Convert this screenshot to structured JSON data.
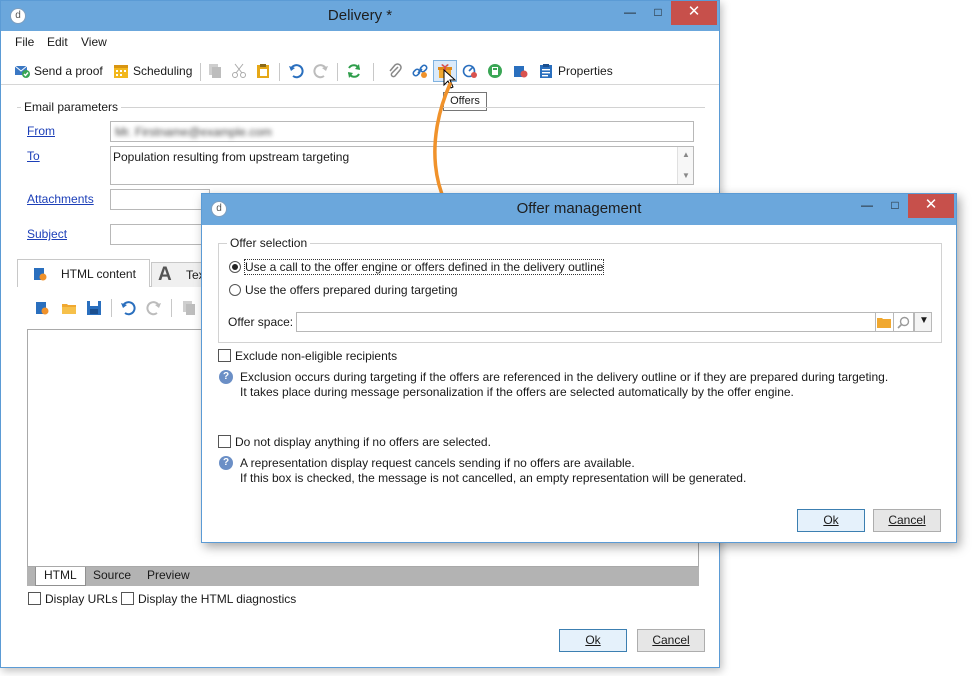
{
  "main_window": {
    "title": "Delivery *",
    "menu": [
      "File",
      "Edit",
      "View"
    ],
    "toolbar": {
      "send_proof": "Send a proof",
      "scheduling": "Scheduling",
      "properties": "Properties",
      "offers_tooltip": "Offers"
    },
    "email_params": {
      "legend": "Email parameters",
      "from_label": "From",
      "from_value": "Mr. Firstname@example.com",
      "to_label": "To",
      "to_value": "Population resulting from upstream targeting",
      "attachments_label": "Attachments",
      "subject_label": "Subject"
    },
    "content_tabs": {
      "html_content": "HTML content",
      "text_partial": "Tex"
    },
    "bottom_tabs": [
      "HTML",
      "Source",
      "Preview"
    ],
    "options": {
      "display_urls": "Display URLs",
      "display_html_diag": "Display the HTML diagnostics"
    },
    "buttons": {
      "ok": "Ok",
      "cancel": "Cancel"
    }
  },
  "dialog": {
    "title": "Offer management",
    "offer_selection": {
      "legend": "Offer selection",
      "option1": "Use a call to the offer engine or offers defined in the delivery outline",
      "option2": "Use the offers prepared during targeting",
      "offer_space_label": "Offer space:",
      "selected_option": 1
    },
    "exclude": {
      "label": "Exclude non-eligible recipients",
      "info_line1": "Exclusion occurs during targeting if the offers are referenced in the delivery outline or if they are prepared during targeting.",
      "info_line2": "It takes place during message personalization if the offers are selected automatically by the offer engine."
    },
    "no_display": {
      "label": "Do not display anything if no offers are selected.",
      "info_line1": "A representation display request cancels sending if no offers are available.",
      "info_line2": "If this box is checked, the message is not cancelled, an empty representation will be generated."
    },
    "buttons": {
      "ok": "Ok",
      "cancel": "Cancel"
    }
  },
  "colors": {
    "titlebar": "#6ba7dc",
    "close_button": "#c7504b",
    "link": "#1c3fb8",
    "arrow": "#f0922b"
  }
}
